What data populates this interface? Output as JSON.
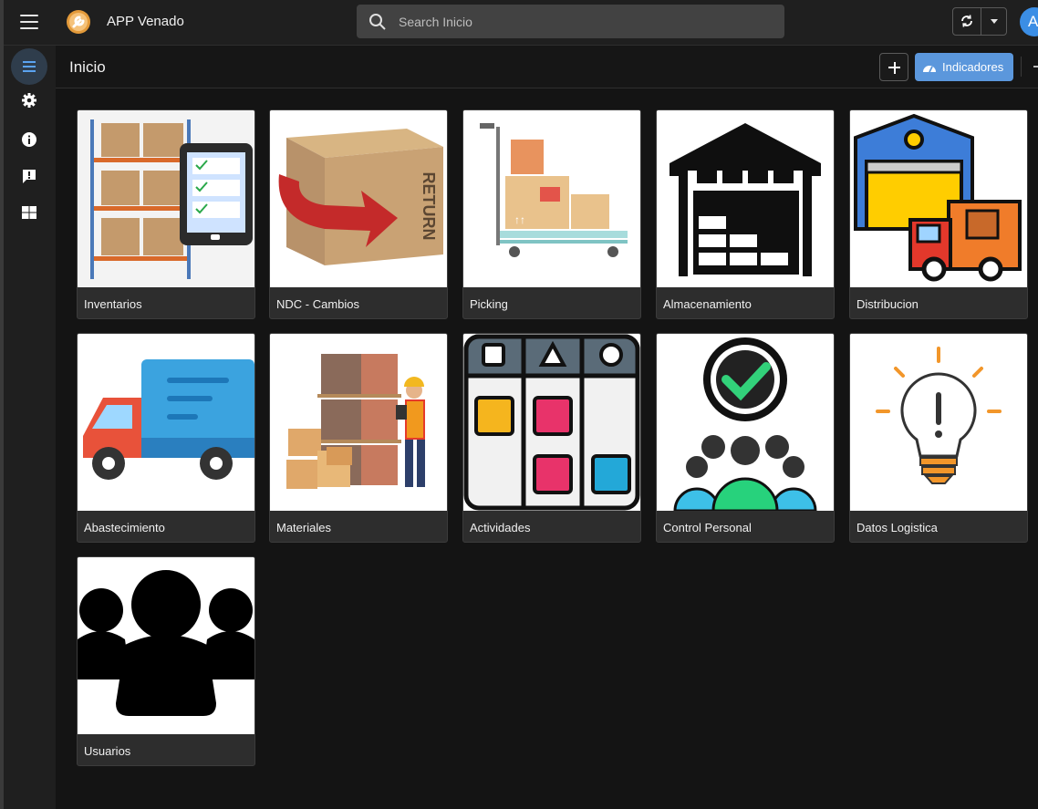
{
  "app": {
    "title": "APP Venado",
    "user_initial": "A"
  },
  "search": {
    "placeholder": "Search Inicio"
  },
  "page": {
    "title": "Inicio"
  },
  "toolbar": {
    "indicators_label": "Indicadores"
  },
  "colors": {
    "accent": "#5b97dc",
    "topbar": "#1f1f1f",
    "background": "#141414",
    "tile": "#2d2d2d"
  },
  "sidebar": {
    "items": [
      {
        "icon": "list-icon"
      },
      {
        "icon": "gear-icon"
      },
      {
        "icon": "info-icon"
      },
      {
        "icon": "feedback-icon"
      },
      {
        "icon": "grid-icon"
      }
    ]
  },
  "tiles": [
    {
      "label": "Inventarios",
      "icon": "inventory-shelf-tablet-image"
    },
    {
      "label": "NDC - Cambios",
      "icon": "return-box-image"
    },
    {
      "label": "Picking",
      "icon": "cart-boxes-image"
    },
    {
      "label": "Almacenamiento",
      "icon": "warehouse-image"
    },
    {
      "label": "Distribucion",
      "icon": "warehouse-truck-image"
    },
    {
      "label": "Abastecimiento",
      "icon": "truck-image"
    },
    {
      "label": "Materiales",
      "icon": "worker-boxes-image"
    },
    {
      "label": "Actividades",
      "icon": "kanban-board-image"
    },
    {
      "label": "Control Personal",
      "icon": "team-check-image"
    },
    {
      "label": "Datos Logistica",
      "icon": "lightbulb-image"
    },
    {
      "label": "Usuarios",
      "icon": "users-group-image"
    }
  ],
  "return_box_text": "RETURN"
}
